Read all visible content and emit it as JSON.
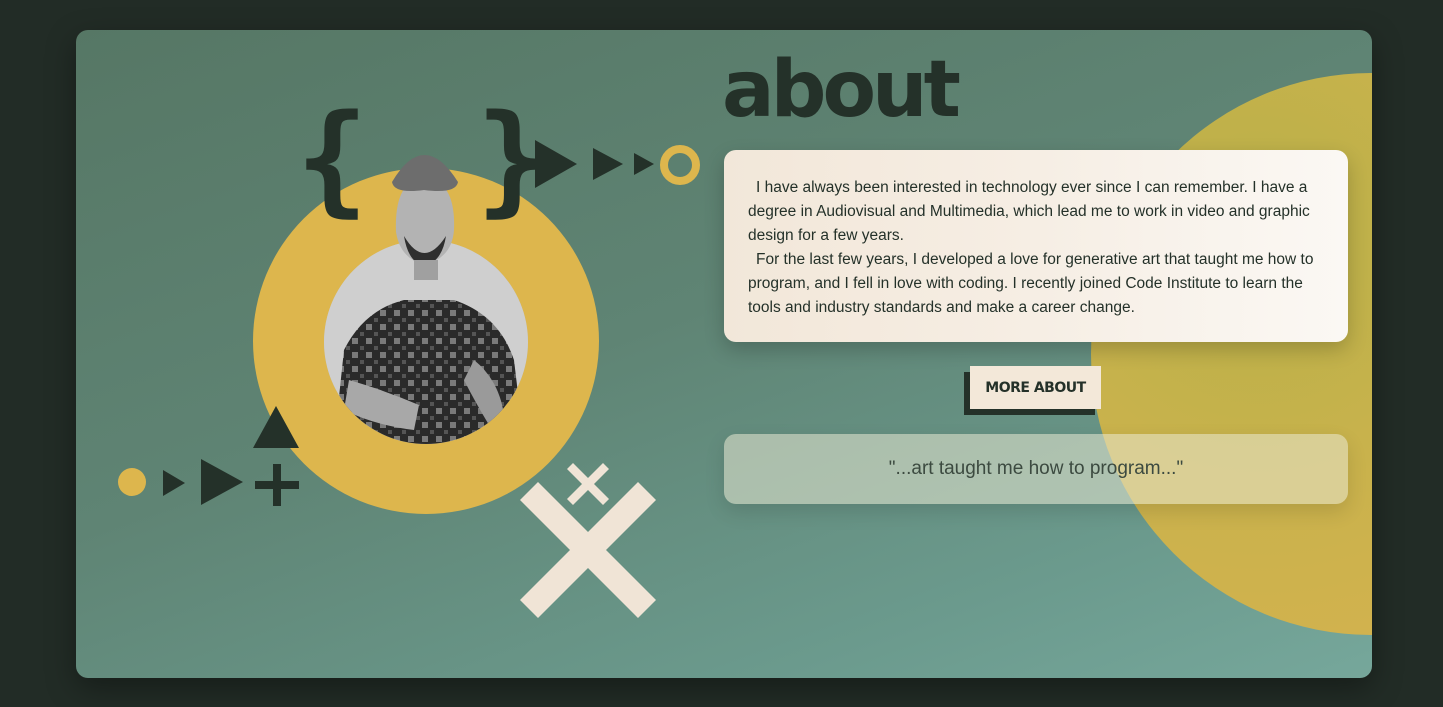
{
  "section": {
    "title": "about"
  },
  "about_text": {
    "paragraph_1": "I have always been interested in technology ever since I can remember. I have a degree in Audiovisual and Multimedia, which lead me to work in video and graphic design for a few years.",
    "paragraph_2": "For the last few years, I developed a love for generative art that taught me how to program, and I fell in love with coding. I recently joined Code Institute to learn the tools and industry standards and make a career change."
  },
  "buttons": {
    "more_about": "MORE ABOUT"
  },
  "quote": {
    "text": "\"...art taught me how to program...\""
  },
  "decorations": {
    "open_brace": "{",
    "close_brace": "}"
  },
  "colors": {
    "page_background": "#222c26",
    "card_green": "#5f8474",
    "accent_yellow": "#ddb64d",
    "cream": "#f3e8d9",
    "dark_green": "#243129"
  },
  "icons": [
    "play-triangle-icon",
    "ring-icon",
    "dot-icon",
    "plus-icon",
    "triangle-icon",
    "x-mark-icon",
    "curly-brace-icon"
  ]
}
